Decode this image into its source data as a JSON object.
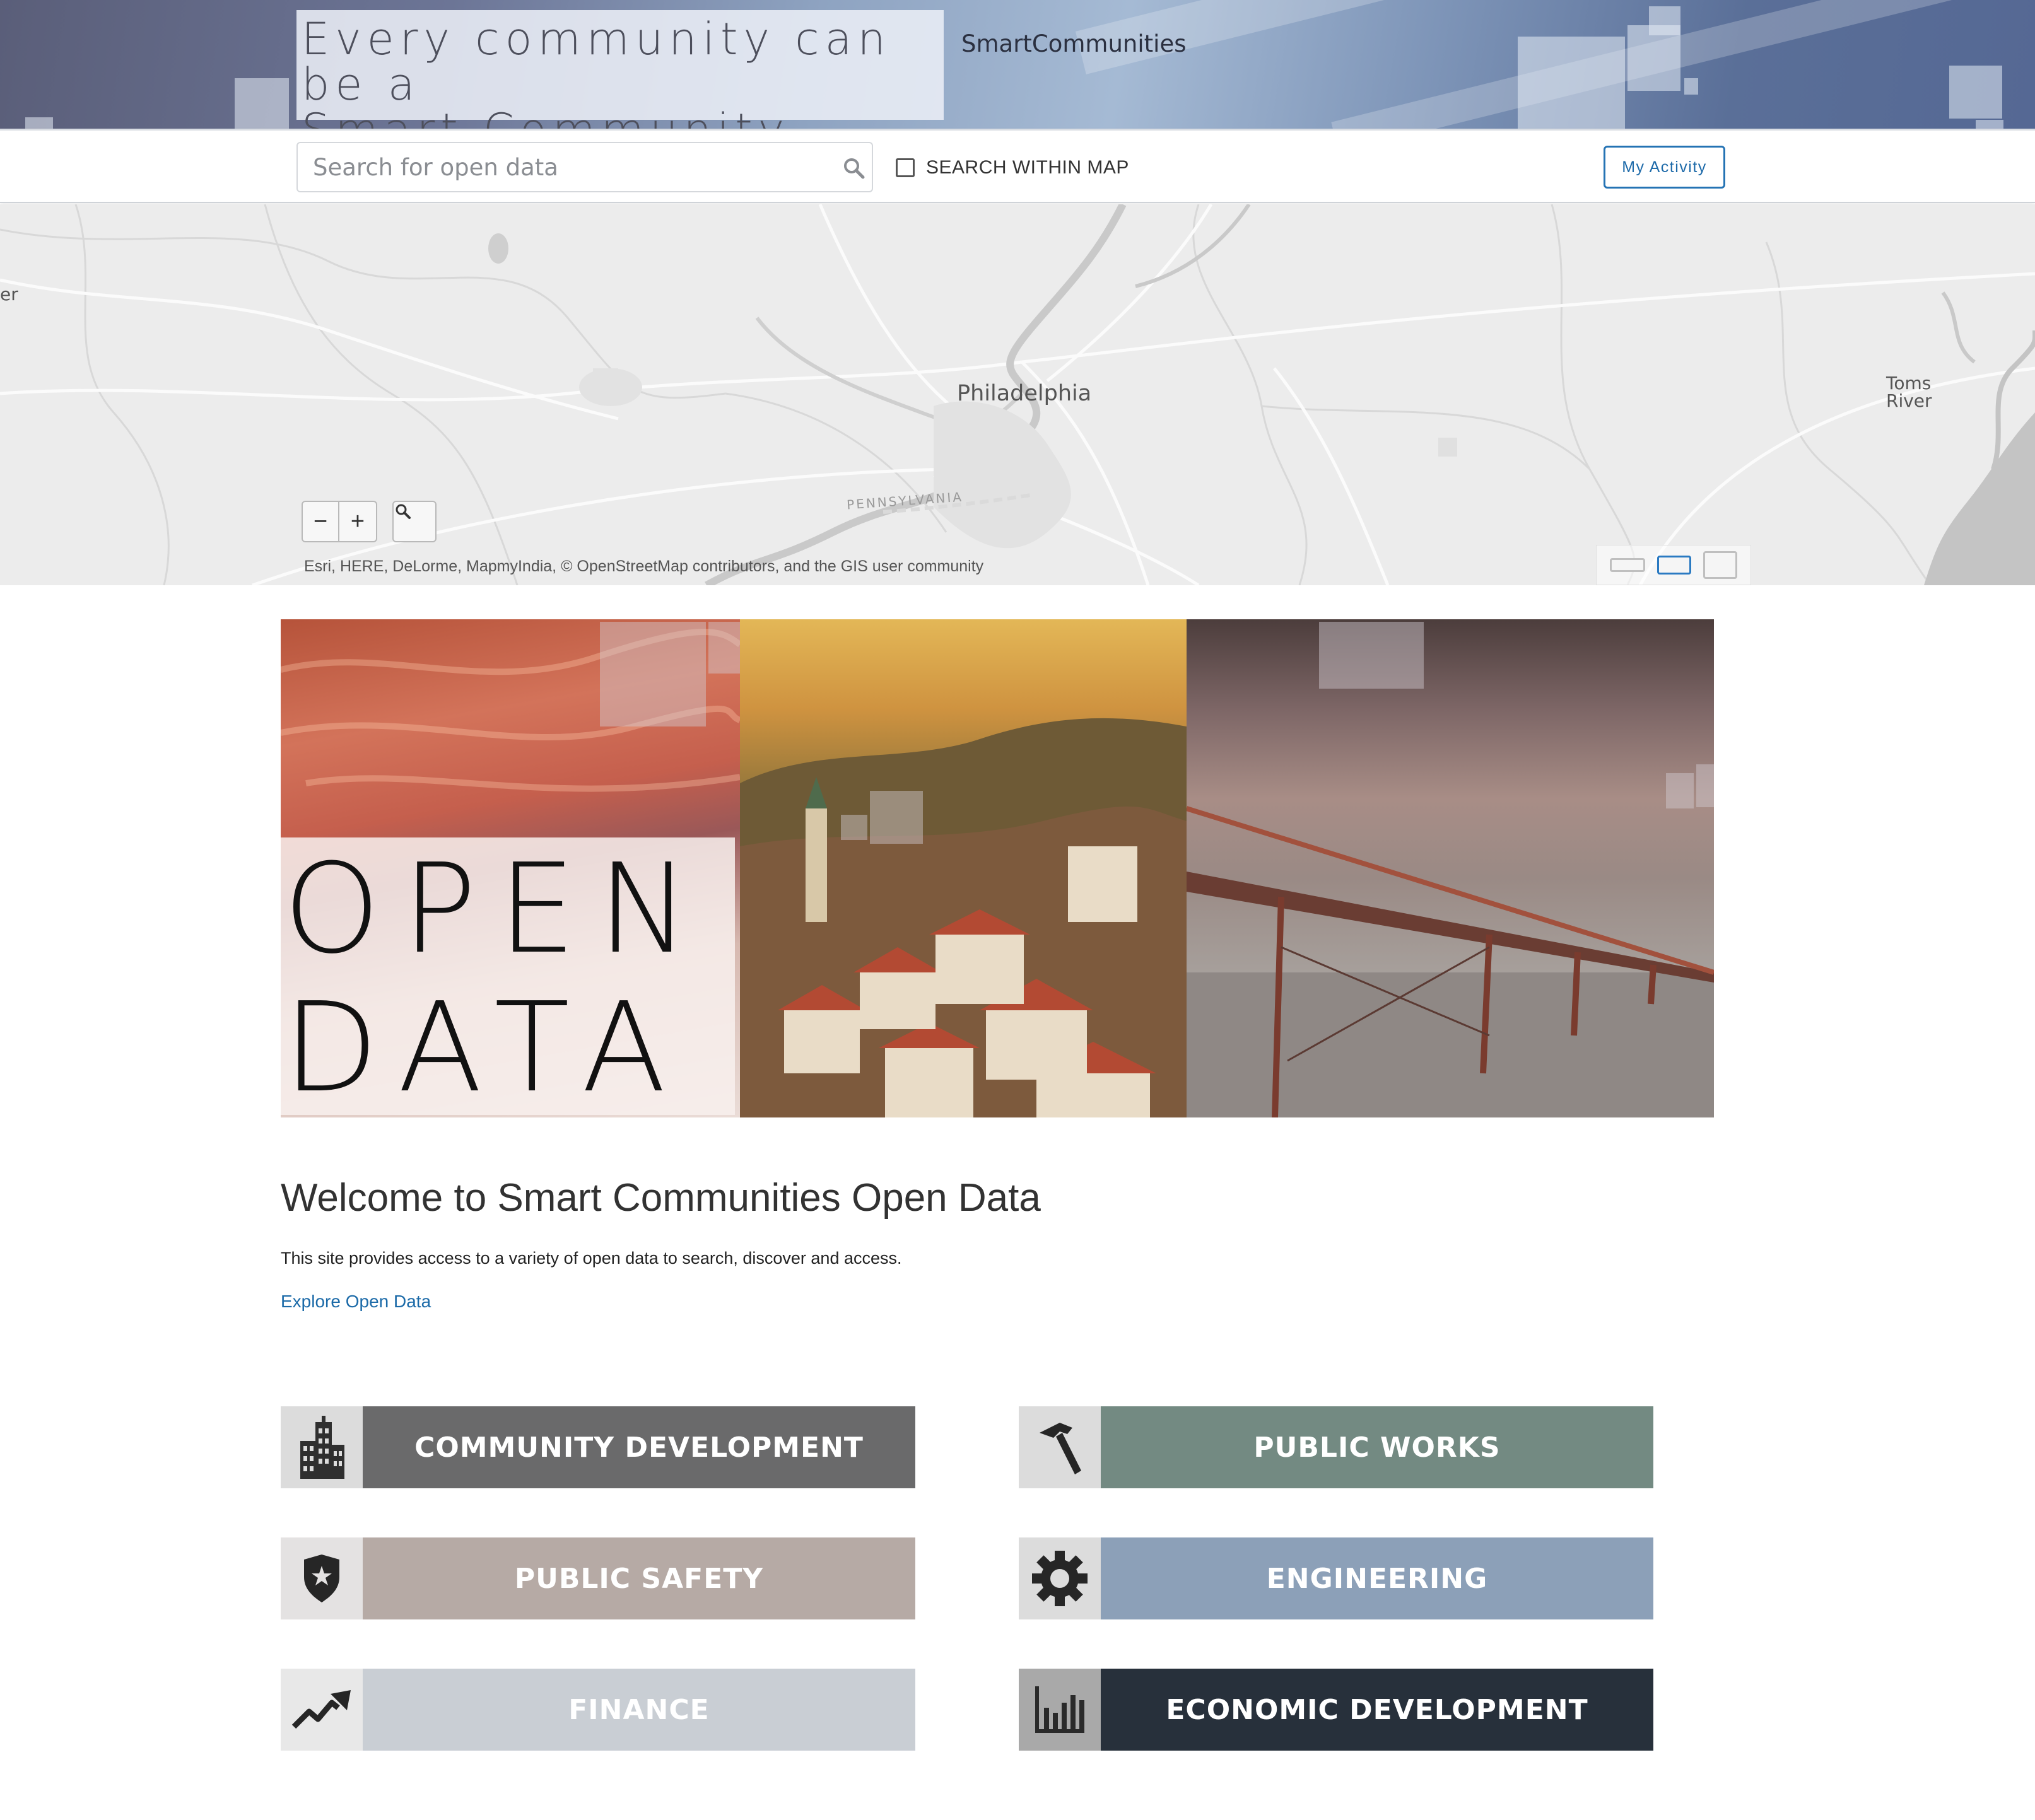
{
  "header": {
    "tagline": "Every community can be a\nSmart Community.",
    "brand": "SmartCommunities"
  },
  "search": {
    "placeholder": "Search for open data",
    "value": "",
    "within_map_label": "SEARCH WITHIN MAP",
    "within_map_checked": false,
    "my_activity_label": "My Activity"
  },
  "map": {
    "labels": {
      "city": "Philadelphia",
      "state": "PENNSYLVANIA",
      "toms_river": "Toms\nRiver",
      "edge": "er"
    },
    "zoom_out": "−",
    "zoom_in": "+",
    "attribution": "Esri, HERE, DeLorme, MapmyIndia, © OpenStreetMap contributors, and the GIS user community",
    "view_options": [
      "small",
      "medium",
      "large"
    ],
    "selected_view": "medium"
  },
  "hero": {
    "text": "OPEN\nDATA"
  },
  "welcome": {
    "title": "Welcome to Smart Communities Open Data",
    "description": "This site provides access to a variety of open data to search, discover and access.",
    "link": "Explore Open Data"
  },
  "categories": [
    {
      "label": "COMMUNITY DEVELOPMENT",
      "icon": "buildings-icon",
      "color": "#6a6a6b",
      "icon_bg": "#dcdcdc"
    },
    {
      "label": "PUBLIC WORKS",
      "icon": "hammer-icon",
      "color": "#738a82",
      "icon_bg": "#dcdcdc"
    },
    {
      "label": "PUBLIC SAFETY",
      "icon": "shield-star-icon",
      "color": "#b6aaa5",
      "icon_bg": "#e4e2e2"
    },
    {
      "label": "ENGINEERING",
      "icon": "gear-icon",
      "color": "#8ca0b8",
      "icon_bg": "#dcdcdc"
    },
    {
      "label": "FINANCE",
      "icon": "trend-up-icon",
      "color": "#c9ced4",
      "icon_bg": "#e8e8e8"
    },
    {
      "label": "ECONOMIC DEVELOPMENT",
      "icon": "bar-chart-icon",
      "color": "#27303b",
      "icon_bg": "#a9a9a9"
    }
  ]
}
